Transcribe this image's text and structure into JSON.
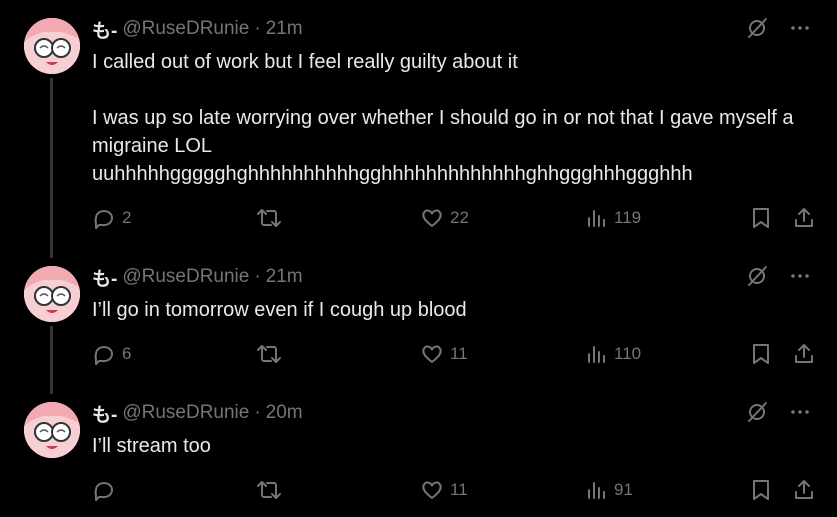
{
  "tweets": [
    {
      "name": "も-",
      "handle": "@RuseDRunie",
      "separator": "·",
      "time": "21m",
      "text": "I called out of work but I feel really guilty about it\n\nI was up so late worrying over whether I should go in or not that I gave myself a migraine LOL\nuuhhhhhggggghghhhhhhhhhhgghhhhhhhhhhhhhghhggghhhggghhh",
      "replies": "2",
      "retweets": "",
      "likes": "22",
      "views": "119"
    },
    {
      "name": "も-",
      "handle": "@RuseDRunie",
      "separator": "·",
      "time": "21m",
      "text": "I’ll go in tomorrow even if I cough up blood",
      "replies": "6",
      "retweets": "",
      "likes": "11",
      "views": "110"
    },
    {
      "name": "も-",
      "handle": "@RuseDRunie",
      "separator": "·",
      "time": "20m",
      "text": "I’ll stream too",
      "replies": "",
      "retweets": "",
      "likes": "11",
      "views": "91"
    }
  ],
  "icons": {
    "reply": "reply-icon",
    "retweet": "retweet-icon",
    "like": "heart-icon",
    "views": "views-icon",
    "bookmark": "bookmark-icon",
    "share": "share-icon",
    "grok": "grok-icon",
    "more": "more-icon"
  },
  "colors": {
    "background": "#000000",
    "text": "#e7e9ea",
    "muted": "#71767b"
  }
}
